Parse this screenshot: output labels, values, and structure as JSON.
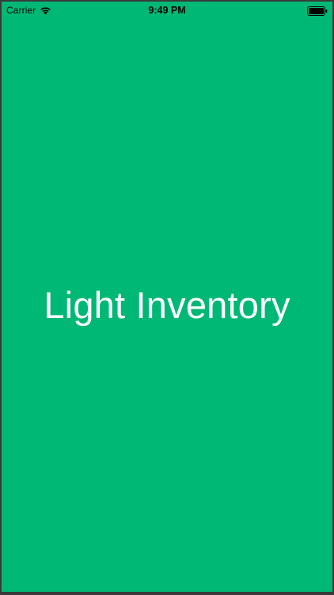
{
  "status_bar": {
    "carrier": "Carrier",
    "time": "9:49 PM",
    "wifi_icon": "wifi-icon",
    "battery_icon": "battery-icon"
  },
  "splash": {
    "title": "Light Inventory"
  },
  "colors": {
    "background": "#00b876",
    "title_text": "#ffffff",
    "status_text": "#000000"
  }
}
